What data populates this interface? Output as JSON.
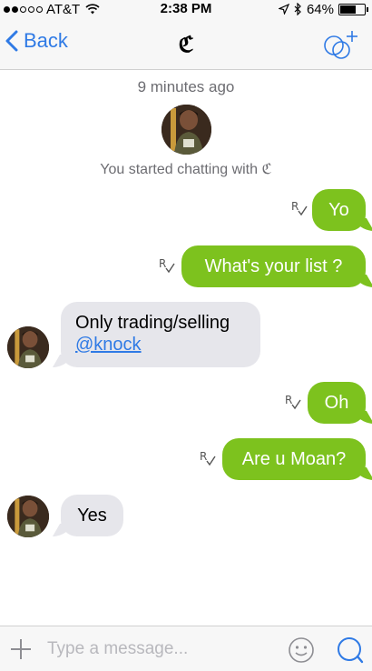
{
  "status_bar": {
    "carrier": "AT&T",
    "time": "2:38 PM",
    "battery_percent": "64%",
    "battery_level": 0.64,
    "signal_bars_filled": 2,
    "signal_bars_total": 5
  },
  "nav": {
    "back_label": "Back",
    "title": "ℭ",
    "accent_color": "#2f7ae5"
  },
  "chat": {
    "timestamp": "9 minutes ago",
    "started_text": "You started chatting with ℭ",
    "outgoing_color": "#7dc21e",
    "incoming_color": "#e6e6eb",
    "messages": [
      {
        "direction": "out",
        "text": "Yo",
        "receipt": "read-receipt-icon"
      },
      {
        "direction": "out",
        "text": "What's your list ?",
        "receipt": "read-receipt-icon"
      },
      {
        "direction": "in",
        "text": "Only trading/selling",
        "mention": "@knock"
      },
      {
        "direction": "out",
        "text": "Oh",
        "receipt": "read-receipt-icon"
      },
      {
        "direction": "out",
        "text": "Are u Moan?",
        "receipt": "read-receipt-icon"
      },
      {
        "direction": "in",
        "text": "Yes"
      }
    ]
  },
  "input": {
    "placeholder": "Type a message..."
  }
}
